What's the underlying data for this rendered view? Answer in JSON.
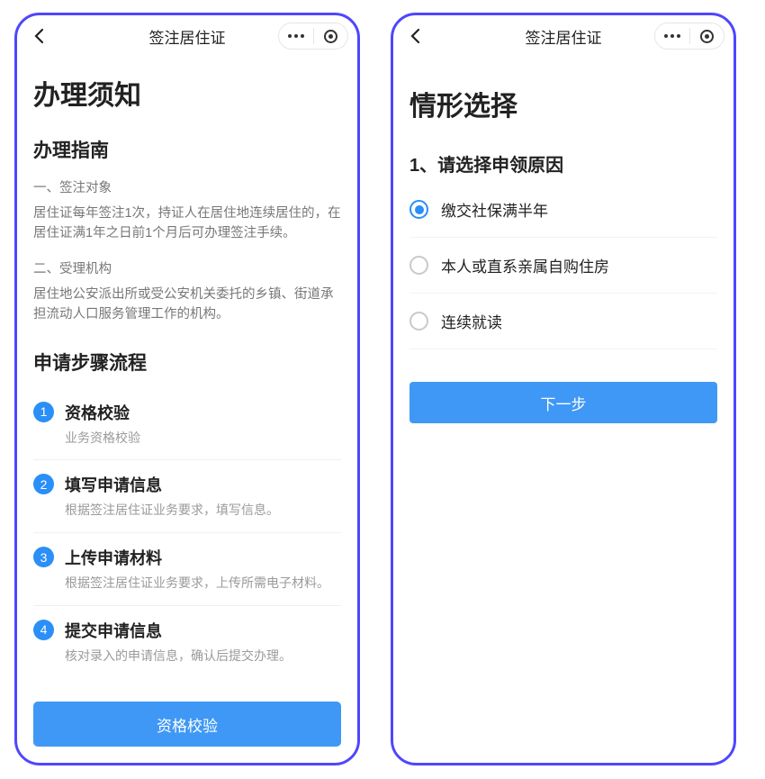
{
  "left": {
    "title_bar": "签注居住证",
    "h1": "办理须知",
    "guide_heading": "办理指南",
    "guide_sec1_label": "一、签注对象",
    "guide_sec1_text": "居住证每年签注1次，持证人在居住地连续居住的，在居住证满1年之日前1个月后可办理签注手续。",
    "guide_sec2_label": "二、受理机构",
    "guide_sec2_text": "居住地公安派出所或受公安机关委托的乡镇、街道承担流动人口服务管理工作的机构。",
    "steps_heading": "申请步骤流程",
    "steps": [
      {
        "num": "1",
        "title": "资格校验",
        "desc": "业务资格校验"
      },
      {
        "num": "2",
        "title": "填写申请信息",
        "desc": "根据签注居住证业务要求，填写信息。"
      },
      {
        "num": "3",
        "title": "上传申请材料",
        "desc": "根据签注居住证业务要求，上传所需电子材料。"
      },
      {
        "num": "4",
        "title": "提交申请信息",
        "desc": "核对录入的申请信息，确认后提交办理。"
      }
    ],
    "primary_button": "资格校验"
  },
  "right": {
    "title_bar": "签注居住证",
    "h1": "情形选择",
    "question": "1、请选择申领原因",
    "options": [
      {
        "label": "缴交社保满半年",
        "selected": true
      },
      {
        "label": "本人或直系亲属自购住房",
        "selected": false
      },
      {
        "label": "连续就读",
        "selected": false
      }
    ],
    "next_button": "下一步"
  },
  "colors": {
    "primary": "#3f98f5",
    "frame": "#4f46ff"
  }
}
